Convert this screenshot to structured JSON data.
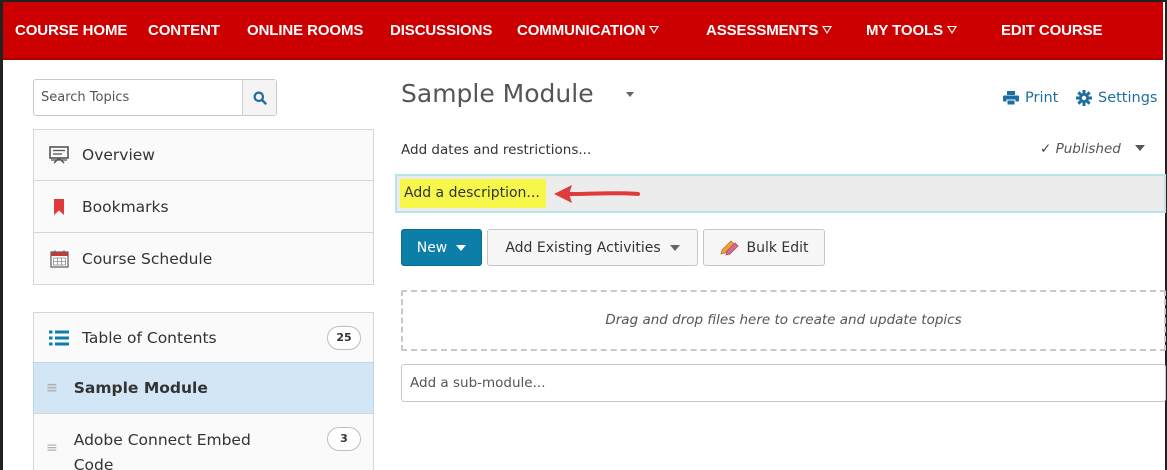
{
  "nav": {
    "items": [
      {
        "label": "COURSE HOME"
      },
      {
        "label": "CONTENT"
      },
      {
        "label": "ONLINE ROOMS"
      },
      {
        "label": "DISCUSSIONS"
      },
      {
        "label": "COMMUNICATION",
        "dropdown": true
      },
      {
        "label": "ASSESSMENTS",
        "dropdown": true
      },
      {
        "label": "MY TOOLS",
        "dropdown": true
      },
      {
        "label": "EDIT COURSE"
      }
    ],
    "color": "#cc0000"
  },
  "sidebar": {
    "search_placeholder": "Search Topics",
    "items": [
      {
        "label": "Overview",
        "icon": "overview-icon"
      },
      {
        "label": "Bookmarks",
        "icon": "bookmark-icon"
      },
      {
        "label": "Course Schedule",
        "icon": "calendar-icon"
      }
    ],
    "toc": {
      "label": "Table of Contents",
      "count": "25"
    },
    "modules": [
      {
        "label": "Sample Module",
        "selected": true
      },
      {
        "label": "Adobe Connect Embed Code",
        "count": "3"
      }
    ]
  },
  "main": {
    "title": "Sample Module",
    "print_label": "Print",
    "settings_label": "Settings",
    "dates_label": "Add dates and restrictions...",
    "status_label": "Published",
    "description_placeholder": "Add a description...",
    "new_label": "New",
    "existing_label": "Add Existing Activities",
    "bulk_label": "Bulk Edit",
    "dropzone_label": "Drag and drop files here to create and update topics",
    "submodule_placeholder": "Add a sub-module...",
    "accent": "#0d7ea8",
    "highlight": "#f7f74a",
    "arrow_color": "#e03a3a"
  }
}
